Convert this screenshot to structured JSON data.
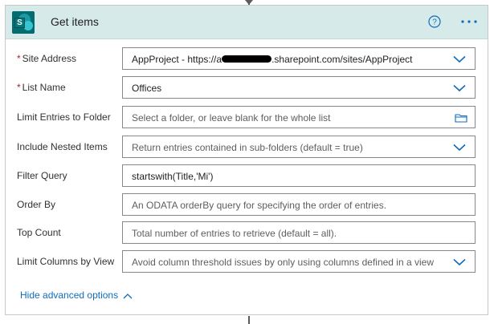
{
  "action": {
    "title": "Get items",
    "app_icon": "sharepoint-icon",
    "app_icon_letter": "S",
    "accent_color": "#0f6cbd",
    "header_color": "#d7eaea"
  },
  "fields": {
    "site_address": {
      "label": "Site Address",
      "required_mark": "*",
      "value_prefix": "AppProject - https://a",
      "value_suffix": ".sharepoint.com/sites/AppProject"
    },
    "list_name": {
      "label": "List Name",
      "required_mark": "*",
      "value": "Offices"
    },
    "limit_folder": {
      "label": "Limit Entries to Folder",
      "placeholder": "Select a folder, or leave blank for the whole list"
    },
    "nested_items": {
      "label": "Include Nested Items",
      "value": "Return entries contained in sub-folders (default = true)"
    },
    "filter_query": {
      "label": "Filter Query",
      "value": "startswith(Title,'Mi')"
    },
    "order_by": {
      "label": "Order By",
      "placeholder": "An ODATA orderBy query for specifying the order of entries."
    },
    "top_count": {
      "label": "Top Count",
      "placeholder": "Total number of entries to retrieve (default = all)."
    },
    "limit_columns": {
      "label": "Limit Columns by View",
      "value": "Avoid column threshold issues by only using columns defined in a view"
    }
  },
  "advanced_toggle": {
    "label": "Hide advanced options"
  }
}
